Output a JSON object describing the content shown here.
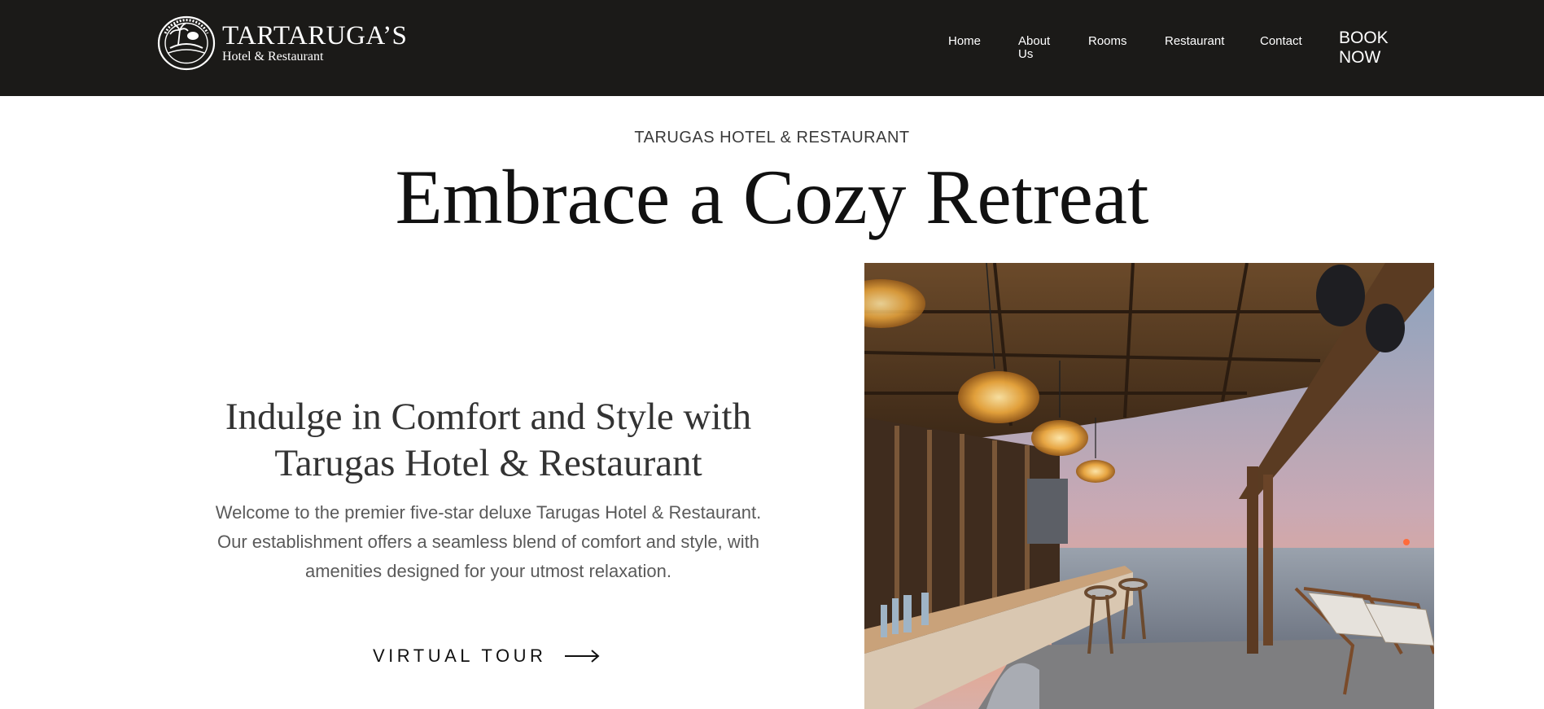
{
  "header": {
    "logo": {
      "name": "TARTARUGA’S",
      "subtitle": "Hotel & Restaurant",
      "icon": "turtle-seal-icon"
    },
    "nav": {
      "home": "Home",
      "about": "About Us",
      "rooms": "Rooms",
      "restaurant": "Restaurant",
      "contact": "Contact",
      "book": "BOOK NOW"
    }
  },
  "hero": {
    "kicker": "TARUGAS HOTEL & RESTAURANT",
    "title": "Embrace a Cozy Retreat"
  },
  "intro": {
    "heading": "Indulge in Comfort and Style with Tarugas Hotel & Restaurant",
    "paragraph_1": "Welcome to the premier five-star deluxe Tarugas Hotel & Restaurant.",
    "paragraph_2": "Our establishment offers a seamless blend of comfort and style, with amenities designed for your utmost relaxation.",
    "cta": "VIRTUAL TOUR",
    "cta_icon": "arrow-right-icon"
  },
  "photo": {
    "subject": "terrace-bar-sunset-photo"
  },
  "colors": {
    "header_bg": "#1b1a18",
    "text_dark": "#111111",
    "text_muted": "#5a5a5a"
  }
}
